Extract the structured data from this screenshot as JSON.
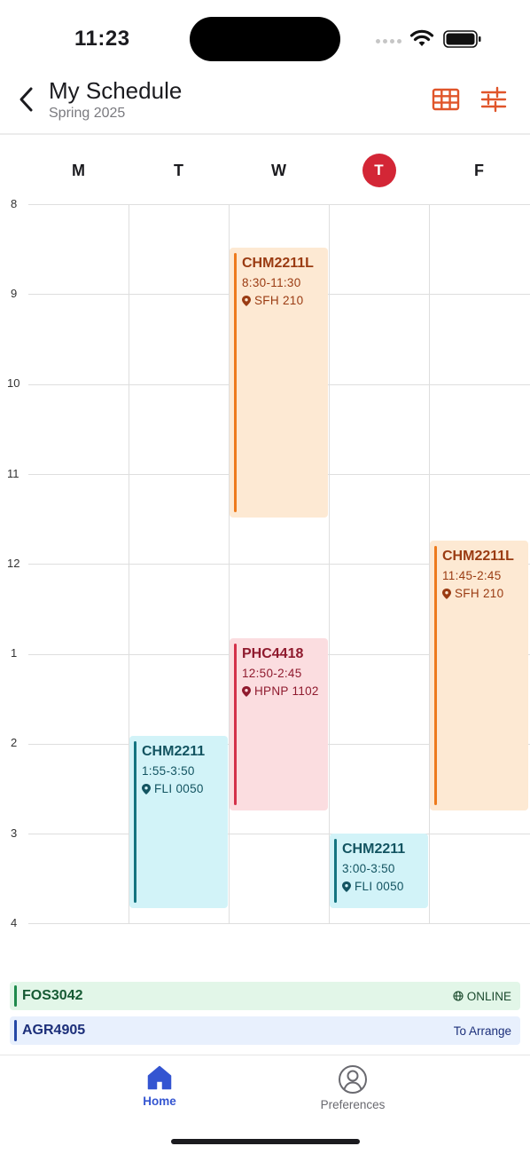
{
  "status_bar": {
    "time": "11:23"
  },
  "header": {
    "title": "My Schedule",
    "subtitle": "Spring 2025",
    "back_icon": "chevron-left-icon",
    "grid_icon": "grid-view-icon",
    "filter_icon": "sliders-icon",
    "accent_color": "#e0552a"
  },
  "days": [
    {
      "label": "M",
      "today": false
    },
    {
      "label": "T",
      "today": false
    },
    {
      "label": "W",
      "today": false
    },
    {
      "label": "T",
      "today": true
    },
    {
      "label": "F",
      "today": false
    }
  ],
  "hours": [
    "8",
    "9",
    "10",
    "11",
    "12",
    "1",
    "2",
    "3",
    "4"
  ],
  "events": [
    {
      "code": "CHM2211L",
      "time": "8:30-11:30",
      "location": "SFH 210",
      "day": "W",
      "color": "orange"
    },
    {
      "code": "CHM2211L",
      "time": "11:45-2:45",
      "location": "SFH 210",
      "day": "F",
      "color": "orange"
    },
    {
      "code": "PHC4418",
      "time": "12:50-2:45",
      "location": "HPNP 1102",
      "day": "W",
      "color": "pink"
    },
    {
      "code": "CHM2211",
      "time": "1:55-3:50",
      "location": "FLI 0050",
      "day": "T",
      "color": "cyan"
    },
    {
      "code": "CHM2211",
      "time": "3:00-3:50",
      "location": "FLI 0050",
      "day": "Th",
      "color": "cyan"
    }
  ],
  "unscheduled": [
    {
      "code": "FOS3042",
      "note": "ONLINE",
      "icon": "globe-icon"
    },
    {
      "code": "AGR4905",
      "note": "To Arrange"
    }
  ],
  "nav": {
    "home_label": "Home",
    "preferences_label": "Preferences",
    "active_color": "#3455d1"
  }
}
